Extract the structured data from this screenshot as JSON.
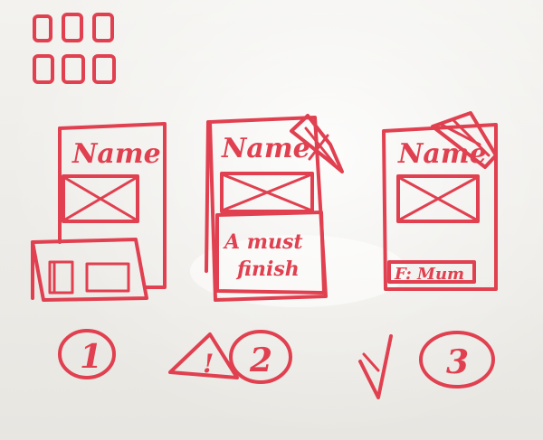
{
  "sketches": [
    {
      "id": "variant-1",
      "name_label": "Name",
      "footer_text": "",
      "step_number": "1",
      "status_icon": "none"
    },
    {
      "id": "variant-2",
      "name_label": "Name",
      "footer_text_line1": "A must",
      "footer_text_line2": "finish",
      "step_number": "2",
      "status_icon": "warning-icon"
    },
    {
      "id": "variant-3",
      "name_label": "Name",
      "footer_text": "F: Mum",
      "step_number": "3",
      "status_icon": "checkmark-icon"
    }
  ],
  "warning_symbol": "!",
  "colors": {
    "marker": "#e0404f",
    "board": "#eceae6"
  }
}
